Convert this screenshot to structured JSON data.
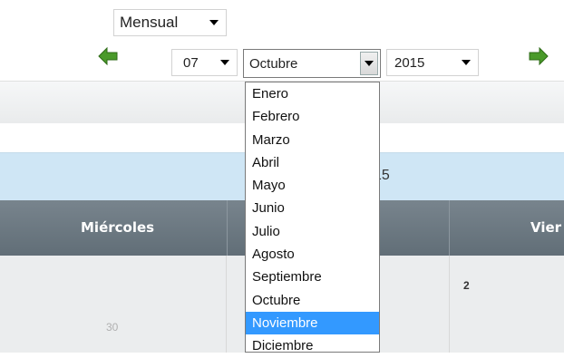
{
  "view_select": {
    "value": "Mensual"
  },
  "nav": {
    "day_select": {
      "value": "07"
    },
    "month_select": {
      "value": "Octubre"
    },
    "year_select": {
      "value": "2015"
    }
  },
  "month_dropdown": {
    "options": [
      "Enero",
      "Febrero",
      "Marzo",
      "Abril",
      "Mayo",
      "Junio",
      "Julio",
      "Agosto",
      "Septiembre",
      "Octubre",
      "Noviembre",
      "Diciembre"
    ],
    "highlighted": "Noviembre"
  },
  "calendar": {
    "title_fragment": "15",
    "headers": [
      "Miércoles",
      "Vier"
    ],
    "days": [
      "30",
      "2"
    ]
  },
  "colors": {
    "accent_green": "#4a9a2a",
    "highlight_blue": "#3399ff",
    "header_band": "#cfe6f5",
    "column_header": "#6a767f"
  }
}
